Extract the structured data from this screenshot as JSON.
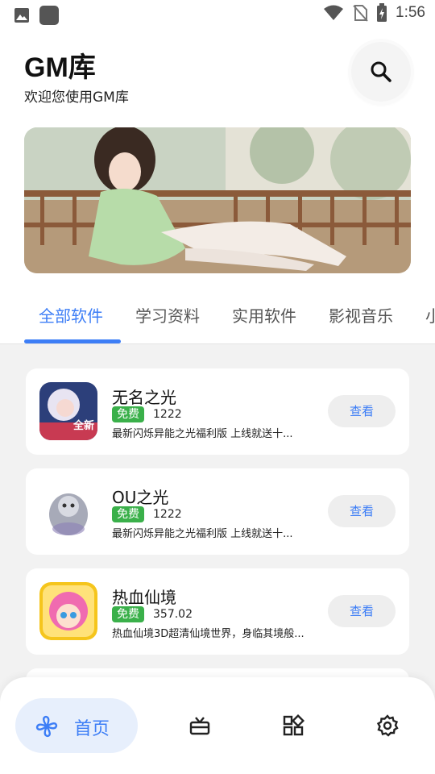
{
  "status_bar": {
    "time": "1:56"
  },
  "header": {
    "title": "GM库",
    "subtitle": "欢迎您使用GM库"
  },
  "search": {
    "icon": "search-icon"
  },
  "tabs": [
    {
      "label": "全部软件",
      "active": true
    },
    {
      "label": "学习资料",
      "active": false
    },
    {
      "label": "实用软件",
      "active": false
    },
    {
      "label": "影视音乐",
      "active": false
    },
    {
      "label": "小",
      "active": false
    }
  ],
  "apps": [
    {
      "name": "无名之光",
      "badge": "免费",
      "size": "1222",
      "desc": "最新闪烁异能之光福利版 上线就送十...",
      "button": "查看"
    },
    {
      "name": "OU之光",
      "badge": "免费",
      "size": "1222",
      "desc": "最新闪烁异能之光福利版 上线就送十...",
      "button": "查看"
    },
    {
      "name": "热血仙境",
      "badge": "免费",
      "size": "357.02",
      "desc": "热血仙境3D超清仙境世界，身临其境般...",
      "button": "查看"
    }
  ],
  "bottom_nav": {
    "home_label": "首页",
    "items": [
      "pinwheel-icon",
      "gift-icon",
      "apps-icon",
      "gear-icon"
    ]
  },
  "colors": {
    "accent": "#3d7ef6",
    "badge": "#3ab04a",
    "list_bg": "#f2f2f2"
  }
}
